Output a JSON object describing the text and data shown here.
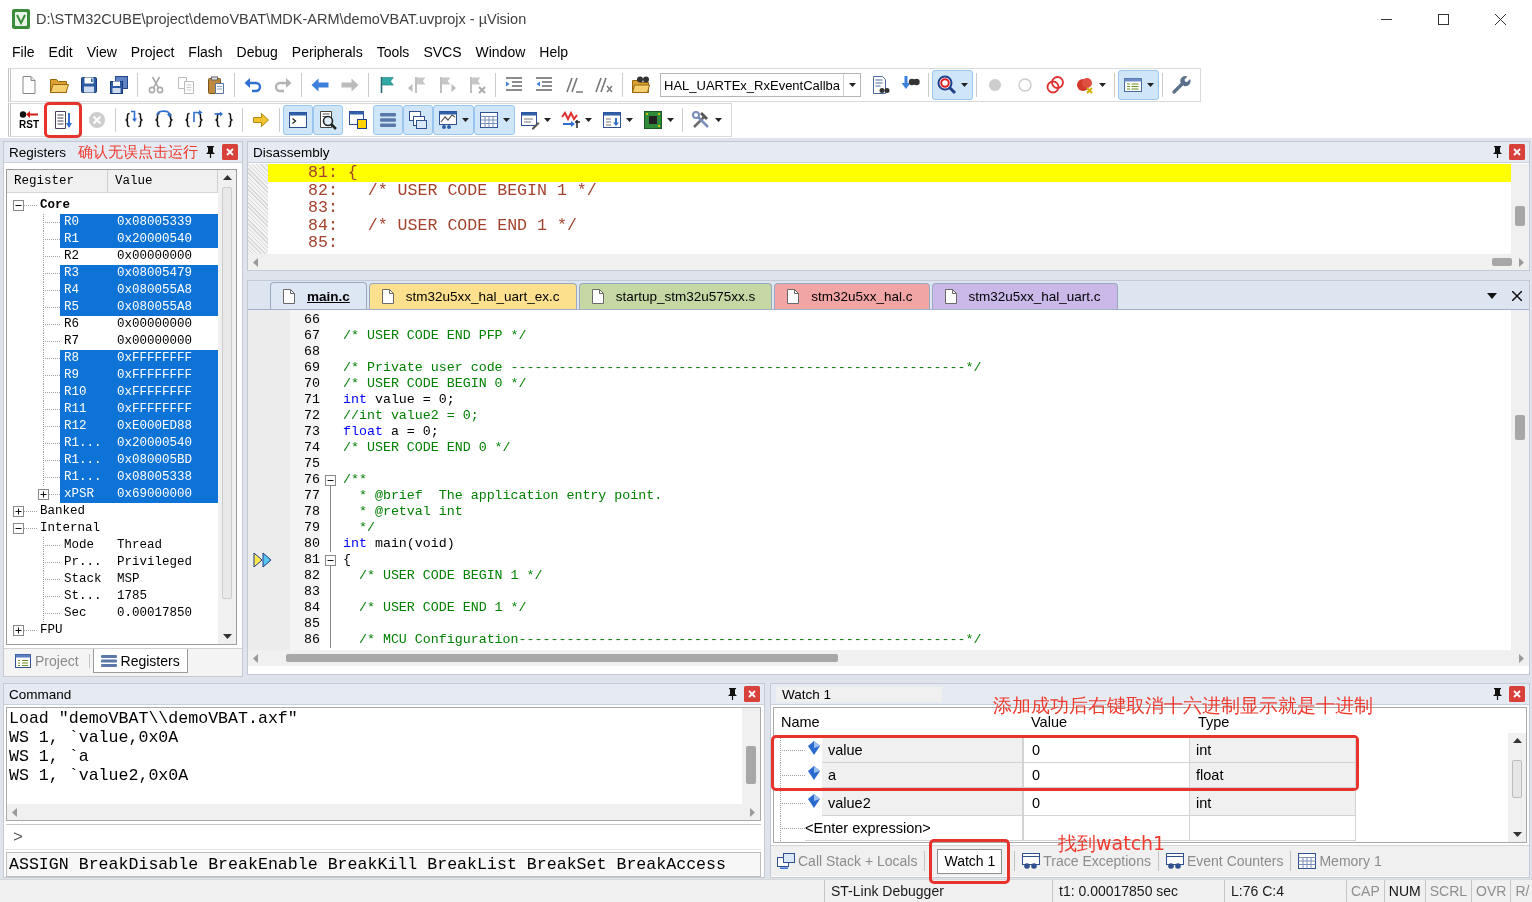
{
  "window": {
    "title": "D:\\STM32CUBE\\project\\demoVBAT\\MDK-ARM\\demoVBAT.uvprojx - µVision"
  },
  "menu": [
    "File",
    "Edit",
    "View",
    "Project",
    "Flash",
    "Debug",
    "Peripherals",
    "Tools",
    "SVCS",
    "Window",
    "Help"
  ],
  "toolbars": [
    {
      "items": [
        {
          "kind": "button",
          "on": false,
          "disabled": false
        },
        {
          "kind": "button",
          "on": false,
          "disabled": false
        },
        {
          "kind": "button",
          "on": false,
          "disabled": false
        },
        {
          "kind": "button",
          "on": false,
          "disabled": false
        },
        {
          "kind": "separator"
        },
        {
          "kind": "button",
          "on": false,
          "disabled": true
        },
        {
          "kind": "button",
          "on": false,
          "disabled": true
        },
        {
          "kind": "button",
          "on": false,
          "disabled": false
        },
        {
          "kind": "separator"
        },
        {
          "kind": "button",
          "on": false,
          "disabled": false
        },
        {
          "kind": "button",
          "on": false,
          "disabled": true
        },
        {
          "kind": "separator"
        },
        {
          "kind": "button",
          "on": false,
          "disabled": false
        },
        {
          "kind": "button",
          "on": false,
          "disabled": true
        },
        {
          "kind": "separator"
        },
        {
          "kind": "button",
          "on": false,
          "disabled": false
        },
        {
          "kind": "button",
          "on": false,
          "disabled": true
        },
        {
          "kind": "button",
          "on": false,
          "disabled": true
        },
        {
          "kind": "button",
          "on": false,
          "disabled": true
        },
        {
          "kind": "separator"
        },
        {
          "kind": "button",
          "on": false,
          "disabled": false
        },
        {
          "kind": "button",
          "on": false,
          "disabled": false
        },
        {
          "kind": "button",
          "on": false,
          "disabled": false
        },
        {
          "kind": "button",
          "on": false,
          "disabled": false
        },
        {
          "kind": "separator"
        },
        {
          "kind": "button",
          "on": false,
          "disabled": false
        },
        {
          "kind": "combo",
          "value": "HAL_UARTEx_RxEventCallba"
        },
        {
          "kind": "button",
          "on": false,
          "disabled": false
        },
        {
          "kind": "button",
          "on": false,
          "disabled": false
        },
        {
          "kind": "separator"
        },
        {
          "kind": "split",
          "on": true,
          "disabled": false
        },
        {
          "kind": "separator"
        },
        {
          "kind": "button",
          "on": false,
          "disabled": true
        },
        {
          "kind": "button",
          "on": false,
          "disabled": true
        },
        {
          "kind": "button",
          "on": false,
          "disabled": false
        },
        {
          "kind": "split",
          "on": false,
          "disabled": false
        },
        {
          "kind": "separator"
        },
        {
          "kind": "split",
          "on": true,
          "disabled": false
        },
        {
          "kind": "separator"
        },
        {
          "kind": "button",
          "on": false,
          "disabled": false
        }
      ]
    },
    {
      "items": [
        {
          "kind": "button",
          "label": "RST",
          "on": false,
          "disabled": false,
          "boxed": false
        },
        {
          "kind": "button",
          "on": false,
          "disabled": false,
          "boxed": true
        },
        {
          "kind": "button",
          "on": false,
          "disabled": true,
          "boxed": false
        },
        {
          "kind": "separator"
        },
        {
          "kind": "button",
          "on": false,
          "disabled": false,
          "boxed": false
        },
        {
          "kind": "button",
          "on": false,
          "disabled": false,
          "boxed": false
        },
        {
          "kind": "button",
          "on": false,
          "disabled": false,
          "boxed": false
        },
        {
          "kind": "button",
          "on": false,
          "disabled": false,
          "boxed": false
        },
        {
          "kind": "separator"
        },
        {
          "kind": "button",
          "on": false,
          "disabled": false,
          "boxed": false
        },
        {
          "kind": "separator"
        },
        {
          "kind": "button",
          "on": true,
          "disabled": false,
          "boxed": false
        },
        {
          "kind": "button",
          "on": true,
          "disabled": false,
          "boxed": false
        },
        {
          "kind": "button",
          "on": false,
          "disabled": false,
          "boxed": false
        },
        {
          "kind": "button",
          "on": true,
          "disabled": false,
          "boxed": false
        },
        {
          "kind": "button",
          "on": true,
          "disabled": false,
          "boxed": false
        },
        {
          "kind": "split",
          "on": true,
          "disabled": false,
          "boxed": false
        },
        {
          "kind": "split",
          "on": true,
          "disabled": false,
          "boxed": false
        },
        {
          "kind": "split",
          "on": false,
          "disabled": false,
          "boxed": false
        },
        {
          "kind": "split",
          "on": false,
          "disabled": false,
          "boxed": false
        },
        {
          "kind": "split",
          "on": false,
          "disabled": false,
          "boxed": false
        },
        {
          "kind": "split",
          "on": false,
          "disabled": false,
          "boxed": false
        },
        {
          "kind": "separator"
        },
        {
          "kind": "split",
          "on": false,
          "disabled": false,
          "boxed": false
        }
      ]
    }
  ],
  "registers": {
    "title": "Registers",
    "annotation": "确认无误点击运行",
    "columns": [
      "Register",
      "Value"
    ],
    "tree": [
      {
        "name": "Core",
        "bold": true,
        "expanded": true,
        "children": [
          {
            "name": "R0",
            "value": "0x08005339",
            "highlighted": true
          },
          {
            "name": "R1",
            "value": "0x20000540",
            "highlighted": true
          },
          {
            "name": "R2",
            "value": "0x00000000",
            "highlighted": false
          },
          {
            "name": "R3",
            "value": "0x08005479",
            "highlighted": true
          },
          {
            "name": "R4",
            "value": "0x080055A8",
            "highlighted": true
          },
          {
            "name": "R5",
            "value": "0x080055A8",
            "highlighted": true
          },
          {
            "name": "R6",
            "value": "0x00000000",
            "highlighted": false
          },
          {
            "name": "R7",
            "value": "0x00000000",
            "highlighted": false
          },
          {
            "name": "R8",
            "value": "0xFFFFFFFF",
            "highlighted": true
          },
          {
            "name": "R9",
            "value": "0xFFFFFFFF",
            "highlighted": true
          },
          {
            "name": "R10",
            "value": "0xFFFFFFFF",
            "highlighted": true
          },
          {
            "name": "R11",
            "value": "0xFFFFFFFF",
            "highlighted": true
          },
          {
            "name": "R12",
            "value": "0xE000ED88",
            "highlighted": true
          },
          {
            "name": "R1...",
            "value": "0x20000540",
            "highlighted": true
          },
          {
            "name": "R1...",
            "value": "0x080005BD",
            "highlighted": true
          },
          {
            "name": "R1...",
            "value": "0x08005338",
            "highlighted": true
          },
          {
            "name": "xPSR",
            "value": "0x69000000",
            "highlighted": true,
            "expanded": false
          }
        ]
      },
      {
        "name": "Banked",
        "bold": false,
        "expanded": false
      },
      {
        "name": "Internal",
        "bold": false,
        "expanded": true,
        "children": [
          {
            "name": "Mode",
            "value": "Thread",
            "highlighted": false
          },
          {
            "name": "Pr...",
            "value": "Privileged",
            "highlighted": false
          },
          {
            "name": "Stack",
            "value": "MSP",
            "highlighted": false
          },
          {
            "name": "St...",
            "value": "1785",
            "highlighted": false
          },
          {
            "name": "Sec",
            "value": "0.00017850",
            "highlighted": false
          }
        ]
      },
      {
        "name": "FPU",
        "bold": false,
        "expanded": false
      }
    ],
    "tabs": [
      {
        "label": "Project",
        "selected": false
      },
      {
        "label": "Registers",
        "selected": true
      }
    ]
  },
  "disassembly": {
    "title": "Disassembly",
    "lines": [
      {
        "text": "81: {",
        "current": true
      },
      {
        "text": "82:   /* USER CODE BEGIN 1 */",
        "current": false
      },
      {
        "text": "83:",
        "current": false
      },
      {
        "text": "84:   /* USER CODE END 1 */",
        "current": false
      },
      {
        "text": "85:",
        "current": false
      }
    ]
  },
  "editor": {
    "tabs": [
      {
        "label": "main.c",
        "selected": true,
        "color": "#dde6f3"
      },
      {
        "label": "stm32u5xx_hal_uart_ex.c",
        "selected": false,
        "color": "#fde08e"
      },
      {
        "label": "startup_stm32u575xx.s",
        "selected": false,
        "color": "#c5d8a4"
      },
      {
        "label": "stm32u5xx_hal.c",
        "selected": false,
        "color": "#f2a5a5"
      },
      {
        "label": "stm32u5xx_hal_uart.c",
        "selected": false,
        "color": "#c9b8e8"
      }
    ],
    "lines": [
      {
        "number": "66",
        "fold": false,
        "current": false
      },
      {
        "number": "67",
        "fold": false,
        "current": false,
        "tokens": [
          {
            "text": "/* USER CODE END PFP */",
            "kind": "comment"
          }
        ]
      },
      {
        "number": "68",
        "fold": false,
        "current": false
      },
      {
        "number": "69",
        "fold": false,
        "current": false,
        "tokens": [
          {
            "text": "/* Private user code ---------------------------------------------------------*/",
            "kind": "comment"
          }
        ]
      },
      {
        "number": "70",
        "fold": false,
        "current": false,
        "tokens": [
          {
            "text": "/* USER CODE BEGIN 0 */",
            "kind": "comment"
          }
        ]
      },
      {
        "number": "71",
        "fold": false,
        "current": false,
        "tokens": [
          {
            "text": "int",
            "kind": "keyword"
          },
          {
            "text": " value = 0;",
            "kind": "plain"
          }
        ]
      },
      {
        "number": "72",
        "fold": false,
        "current": false,
        "tokens": [
          {
            "text": "//int value2 = 0;",
            "kind": "comment"
          }
        ]
      },
      {
        "number": "73",
        "fold": false,
        "current": false,
        "tokens": [
          {
            "text": "float",
            "kind": "keyword"
          },
          {
            "text": " a = 0;",
            "kind": "plain"
          }
        ]
      },
      {
        "number": "74",
        "fold": false,
        "current": false,
        "tokens": [
          {
            "text": "/* USER CODE END 0 */",
            "kind": "comment"
          }
        ]
      },
      {
        "number": "75",
        "fold": false,
        "current": false
      },
      {
        "number": "76",
        "fold": true,
        "current": false,
        "tokens": [
          {
            "text": "/**",
            "kind": "comment"
          }
        ]
      },
      {
        "number": "77",
        "fold": false,
        "current": false,
        "tokens": [
          {
            "text": "  * @brief  The application entry point.",
            "kind": "comment"
          }
        ]
      },
      {
        "number": "78",
        "fold": false,
        "current": false,
        "tokens": [
          {
            "text": "  * @retval int",
            "kind": "comment"
          }
        ]
      },
      {
        "number": "79",
        "fold": false,
        "current": false,
        "tokens": [
          {
            "text": "  */",
            "kind": "comment"
          }
        ]
      },
      {
        "number": "80",
        "fold": false,
        "current": false,
        "tokens": [
          {
            "text": "int",
            "kind": "keyword"
          },
          {
            "text": " main(void)",
            "kind": "plain"
          }
        ]
      },
      {
        "number": "81",
        "fold": true,
        "current": true,
        "tokens": [
          {
            "text": "{",
            "kind": "plain"
          }
        ]
      },
      {
        "number": "82",
        "fold": false,
        "current": false,
        "tokens": [
          {
            "text": "  /* USER CODE BEGIN 1 */",
            "kind": "comment"
          }
        ]
      },
      {
        "number": "83",
        "fold": false,
        "current": false
      },
      {
        "number": "84",
        "fold": false,
        "current": false,
        "tokens": [
          {
            "text": "  /* USER CODE END 1 */",
            "kind": "comment"
          }
        ]
      },
      {
        "number": "85",
        "fold": false,
        "current": false
      },
      {
        "number": "86",
        "fold": false,
        "current": false,
        "tokens": [
          {
            "text": "  /* MCU Configuration--------------------------------------------------------*/",
            "kind": "comment"
          }
        ]
      }
    ]
  },
  "command": {
    "title": "Command",
    "output": [
      "Load \"demoVBAT\\\\demoVBAT.axf\"",
      "WS 1, `value,0x0A",
      "WS 1, `a",
      "WS 1, `value2,0x0A"
    ],
    "prompt": ">",
    "hint": "ASSIGN BreakDisable BreakEnable BreakKill BreakList BreakSet BreakAccess"
  },
  "watch": {
    "title": "Watch 1",
    "annotation": "添加成功后右键取消十六进制显示就是十进制",
    "columns": [
      "Name",
      "Value",
      "Type"
    ],
    "rows": [
      {
        "kind": "variable",
        "name": "value",
        "value": "0",
        "type": "int",
        "boxed": true
      },
      {
        "kind": "variable",
        "name": "a",
        "value": "0",
        "type": "float",
        "boxed": true
      },
      {
        "kind": "variable",
        "name": "value2",
        "value": "0",
        "type": "int",
        "boxed": false
      },
      {
        "kind": "entry",
        "placeholder": "<Enter expression>",
        "boxed": false
      }
    ],
    "tab_annotation": "找到watch1",
    "tabs": [
      {
        "label": "Call Stack + Locals",
        "selected": false,
        "boxed": false
      },
      {
        "label": "Watch 1",
        "selected": true,
        "boxed": true
      },
      {
        "label": "Trace Exceptions",
        "selected": false,
        "boxed": false
      },
      {
        "label": "Event Counters",
        "selected": false,
        "boxed": false
      },
      {
        "label": "Memory 1",
        "selected": false,
        "boxed": false
      }
    ]
  },
  "status_bar": {
    "panes": [
      "ST-Link Debugger",
      "t1: 0.00017850 sec",
      "L:76 C:4"
    ],
    "indicators": [
      {
        "label": "CAP",
        "on": false
      },
      {
        "label": "NUM",
        "on": true
      },
      {
        "label": "SCRL",
        "on": false
      },
      {
        "label": "OVR",
        "on": false
      },
      {
        "label": "R/",
        "on": false
      }
    ]
  }
}
